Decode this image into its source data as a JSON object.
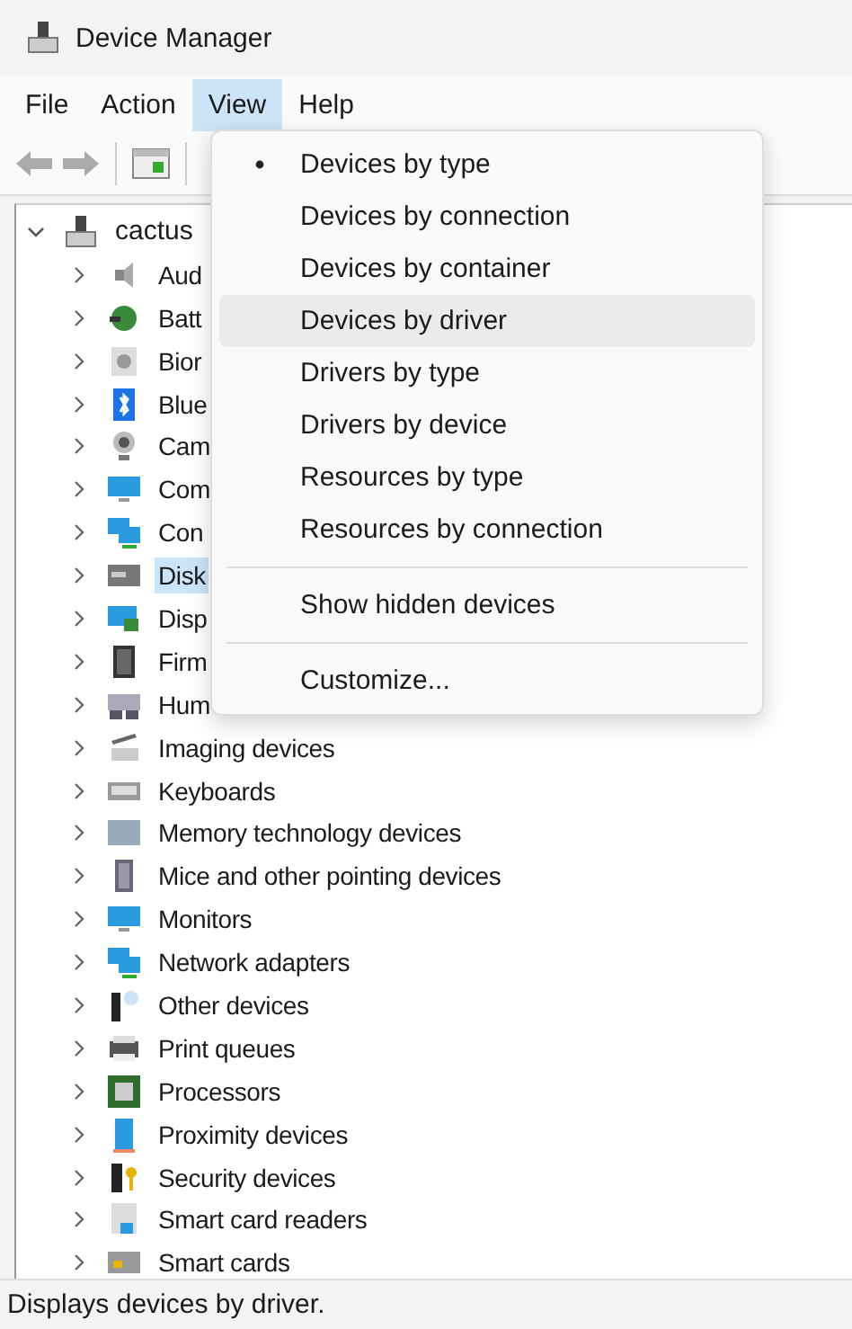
{
  "window": {
    "title": "Device Manager"
  },
  "menu_bar": [
    {
      "label": "File",
      "selected": false
    },
    {
      "label": "Action",
      "selected": false
    },
    {
      "label": "View",
      "selected": true
    },
    {
      "label": "Help",
      "selected": false
    }
  ],
  "tree": {
    "label": "cactus",
    "expanded": true,
    "children": [
      {
        "label": "Aud",
        "expanded": false,
        "selected": false
      },
      {
        "label": "Batt",
        "expanded": false,
        "selected": false
      },
      {
        "label": "Bior",
        "expanded": false,
        "selected": false
      },
      {
        "label": "Blue",
        "expanded": false,
        "selected": false
      },
      {
        "label": "Cam",
        "expanded": false,
        "selected": false
      },
      {
        "label": "Com",
        "expanded": false,
        "selected": false
      },
      {
        "label": "Con",
        "expanded": false,
        "selected": false
      },
      {
        "label": "Disk",
        "expanded": false,
        "selected": true
      },
      {
        "label": "Disp",
        "expanded": false,
        "selected": false
      },
      {
        "label": "Firm",
        "expanded": false,
        "selected": false
      },
      {
        "label": "Hum",
        "expanded": false,
        "selected": false
      },
      {
        "label": "Imaging devices",
        "expanded": false,
        "selected": false
      },
      {
        "label": "Keyboards",
        "expanded": false,
        "selected": false
      },
      {
        "label": "Memory technology devices",
        "expanded": false,
        "selected": false
      },
      {
        "label": "Mice and other pointing devices",
        "expanded": false,
        "selected": false
      },
      {
        "label": "Monitors",
        "expanded": false,
        "selected": false
      },
      {
        "label": "Network adapters",
        "expanded": false,
        "selected": false
      },
      {
        "label": "Other devices",
        "expanded": false,
        "selected": false
      },
      {
        "label": "Print queues",
        "expanded": false,
        "selected": false
      },
      {
        "label": "Processors",
        "expanded": false,
        "selected": false
      },
      {
        "label": "Proximity devices",
        "expanded": false,
        "selected": false
      },
      {
        "label": "Security devices",
        "expanded": false,
        "selected": false
      },
      {
        "label": "Smart card readers",
        "expanded": false,
        "selected": false
      },
      {
        "label": "Smart cards",
        "expanded": false,
        "selected": false
      }
    ]
  },
  "view_menu": [
    {
      "kind": "option",
      "label": "Devices by type",
      "selected": true,
      "highlighted": false
    },
    {
      "kind": "option",
      "label": "Devices by connection",
      "selected": false,
      "highlighted": false
    },
    {
      "kind": "option",
      "label": "Devices by container",
      "selected": false,
      "highlighted": false
    },
    {
      "kind": "option",
      "label": "Devices by driver",
      "selected": false,
      "highlighted": true
    },
    {
      "kind": "option",
      "label": "Drivers by type",
      "selected": false,
      "highlighted": false
    },
    {
      "kind": "option",
      "label": "Drivers by device",
      "selected": false,
      "highlighted": false
    },
    {
      "kind": "option",
      "label": "Resources by type",
      "selected": false,
      "highlighted": false
    },
    {
      "kind": "option",
      "label": "Resources by connection",
      "selected": false,
      "highlighted": false
    },
    {
      "kind": "separator"
    },
    {
      "kind": "option",
      "label": "Show hidden devices",
      "selected": false,
      "highlighted": false
    },
    {
      "kind": "separator"
    },
    {
      "kind": "option",
      "label": "Customize...",
      "selected": false,
      "highlighted": false
    }
  ],
  "status_bar": "Displays devices by driver."
}
